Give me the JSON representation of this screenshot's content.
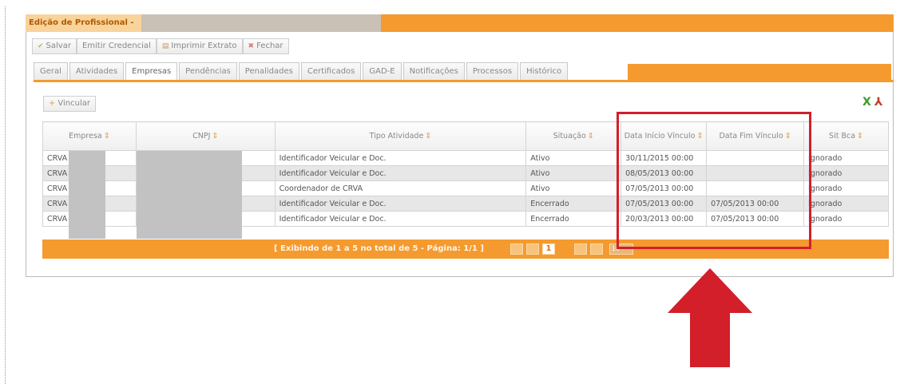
{
  "window": {
    "title": "Edição de Profissional -"
  },
  "toolbar": {
    "salvar": "Salvar",
    "emitir": "Emitir Credencial",
    "imprimir": "Imprimir Extrato",
    "fechar": "Fechar"
  },
  "tabs": [
    "Geral",
    "Atividades",
    "Empresas",
    "Pendências",
    "Penalidades",
    "Certificados",
    "GAD-E",
    "Notificações",
    "Processos",
    "Histórico"
  ],
  "active_tab": "Empresas",
  "actions": {
    "vincular": "Vincular"
  },
  "export": {
    "excel": "X",
    "pdf": "⅄"
  },
  "table": {
    "columns": [
      "Empresa",
      "CNPJ",
      "Tipo Atividade",
      "Situação",
      "Data Início Vínculo",
      "Data Fim Vínculo",
      "Sit Bca"
    ],
    "rows": [
      {
        "empresa": "CRVA",
        "cnpj": "",
        "tipo": "Identificador Veicular e Doc.",
        "situacao": "Ativo",
        "inicio": "30/11/2015 00:00",
        "fim": "",
        "sit": "Ignorado"
      },
      {
        "empresa": "CRVA",
        "cnpj": "",
        "tipo": "Identificador Veicular e Doc.",
        "situacao": "Ativo",
        "inicio": "08/05/2013 00:00",
        "fim": "",
        "sit": "Ignorado"
      },
      {
        "empresa": "CRVA",
        "cnpj": "",
        "tipo": "Coordenador de CRVA",
        "situacao": "Ativo",
        "inicio": "07/05/2013 00:00",
        "fim": "",
        "sit": "Ignorado"
      },
      {
        "empresa": "CRVA",
        "cnpj": "",
        "tipo": "Identificador Veicular e Doc.",
        "situacao": "Encerrado",
        "inicio": "07/05/2013 00:00",
        "fim": "07/05/2013 00:00",
        "sit": "Ignorado"
      },
      {
        "empresa": "CRVA",
        "cnpj": "",
        "tipo": "Identificador Veicular e Doc.",
        "situacao": "Encerrado",
        "inicio": "20/03/2013 00:00",
        "fim": "07/05/2013 00:00",
        "sit": "Ignorado"
      }
    ]
  },
  "pager": {
    "summary": "[ Exibindo de 1 a 5 no total de 5 - Página: 1/1 ]",
    "page": "1",
    "page_size": "10"
  },
  "colors": {
    "accent": "#f59a2f",
    "highlight": "#d21f2a"
  }
}
